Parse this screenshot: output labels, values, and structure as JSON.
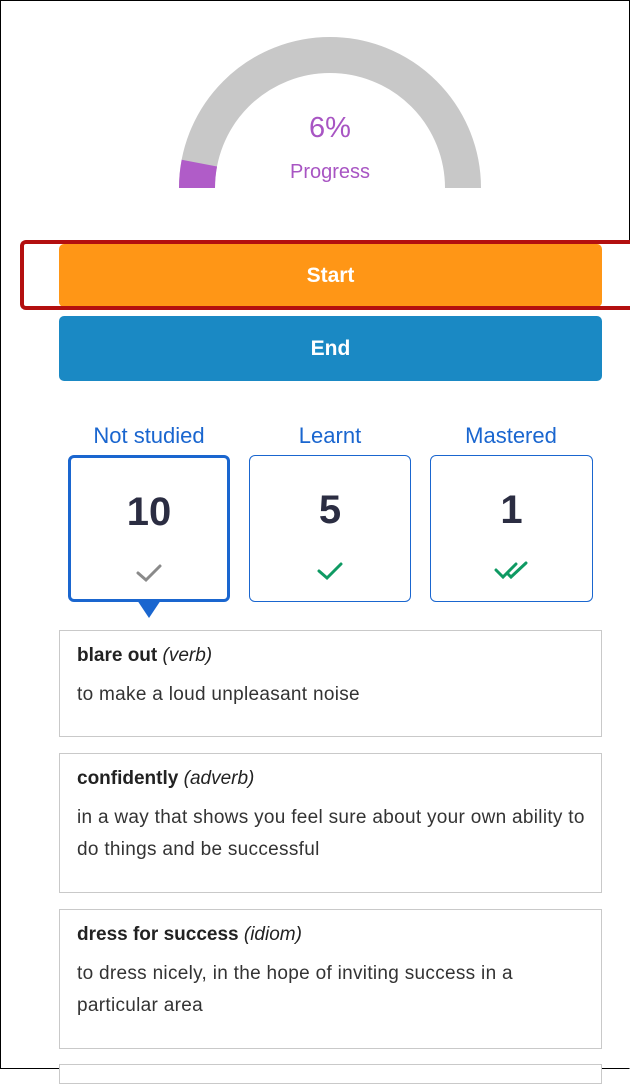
{
  "progress": {
    "percent_text": "6%",
    "label": "Progress",
    "value_fraction": 0.06,
    "track_color": "#c8c8c8",
    "fill_color": "#b05cc8"
  },
  "buttons": {
    "start_label": "Start",
    "end_label": "End",
    "start_color": "#ff9616",
    "end_color": "#1a89c4"
  },
  "tabs": [
    {
      "label": "Not studied",
      "count": "10",
      "icon": "check-icon",
      "icon_color": "#8a8a8a",
      "active": true
    },
    {
      "label": "Learnt",
      "count": "5",
      "icon": "check-icon",
      "icon_color": "#0f9a63",
      "active": false
    },
    {
      "label": "Mastered",
      "count": "1",
      "icon": "double-check-icon",
      "icon_color": "#0f9a63",
      "active": false
    }
  ],
  "words": [
    {
      "term": "blare out",
      "pos": "(verb)",
      "definition": "to make a loud unpleasant noise"
    },
    {
      "term": "confidently",
      "pos": "(adverb)",
      "definition": "in a way that shows you feel sure about your own ability to do things and be successful"
    },
    {
      "term": "dress for success",
      "pos": "(idiom)",
      "definition": "to dress nicely, in the hope of inviting success in a particular area"
    }
  ],
  "accent_color": "#1a66cf"
}
